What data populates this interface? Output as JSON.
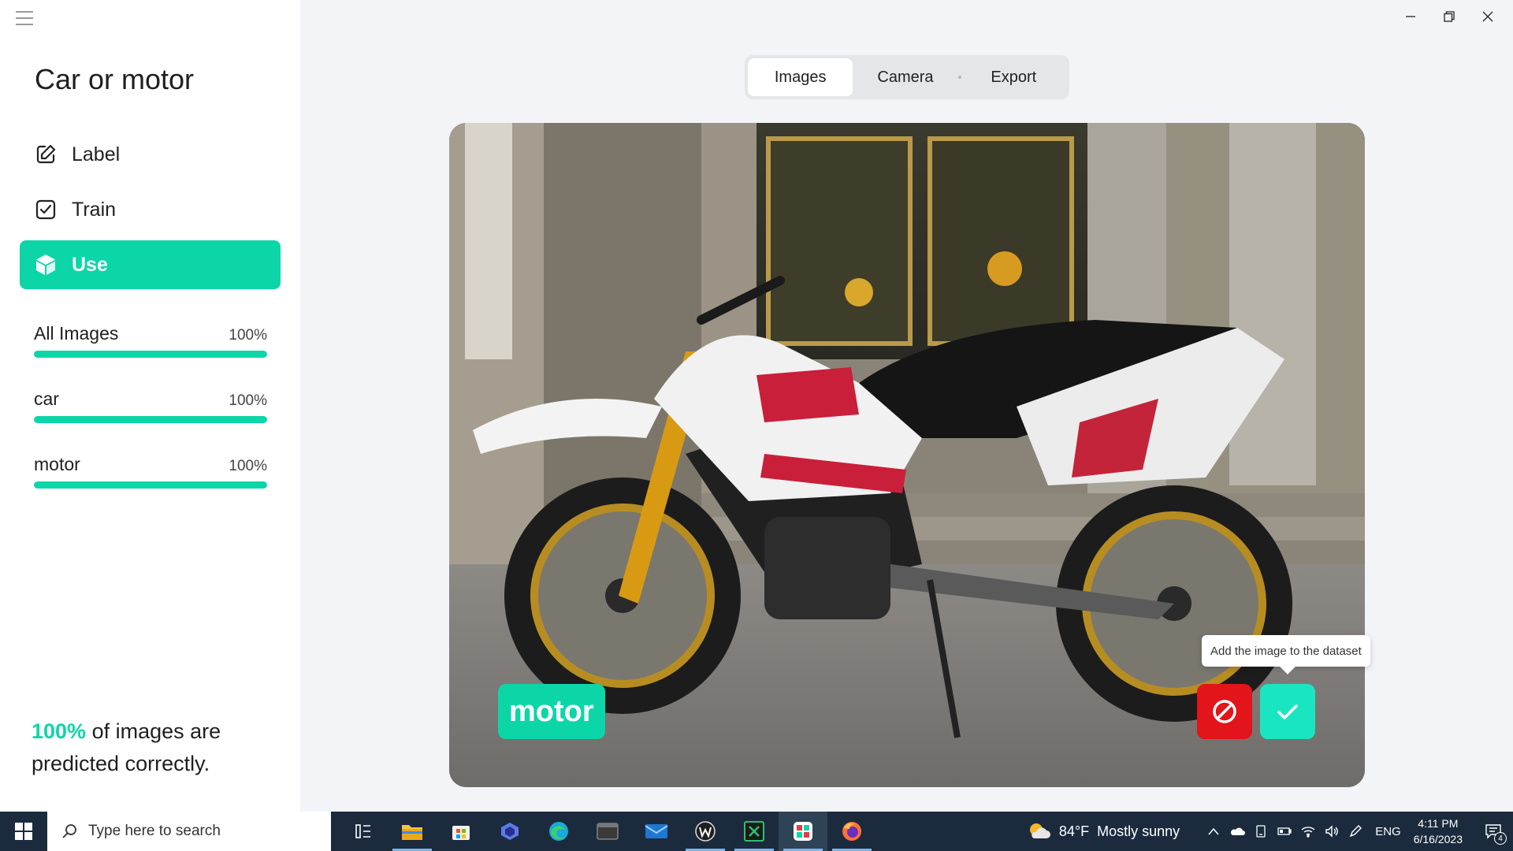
{
  "app": {
    "title": "Car or motor"
  },
  "nav": [
    {
      "label": "Label",
      "icon": "edit-icon"
    },
    {
      "label": "Train",
      "icon": "checkbox-icon"
    },
    {
      "label": "Use",
      "icon": "cube-icon"
    }
  ],
  "stats": [
    {
      "name": "All Images",
      "percent_text": "100%",
      "progress": 1.0
    },
    {
      "name": "car",
      "percent_text": "100%",
      "progress": 1.0
    },
    {
      "name": "motor",
      "percent_text": "100%",
      "progress": 1.0
    }
  ],
  "summary": {
    "accent": "100%",
    "text": " of images are predicted correctly."
  },
  "tabs": [
    {
      "label": "Images",
      "active": true
    },
    {
      "label": "Camera",
      "active": false
    },
    {
      "label": "Export",
      "active": false
    }
  ],
  "preview": {
    "prediction": "motor",
    "tooltip": "Add the image to the dataset"
  },
  "taskbar": {
    "search_placeholder": "Type here to search",
    "weather_temp": "84°F",
    "weather_text": "Mostly sunny",
    "language": "ENG",
    "time": "4:11 PM",
    "date": "6/16/2023",
    "notification_count": "4"
  },
  "colors": {
    "accent": "#0cd6a8",
    "reject": "#e3141a",
    "accept": "#19e6c1",
    "taskbar": "#1b2b3d"
  }
}
